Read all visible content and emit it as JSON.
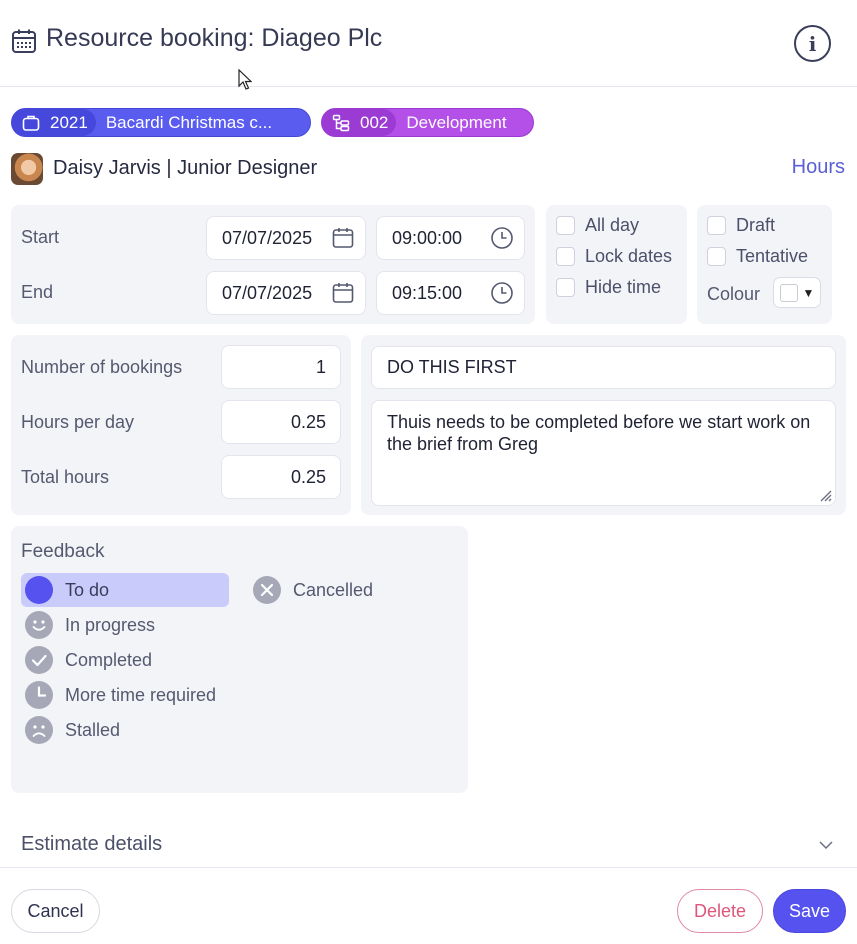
{
  "header": {
    "title": "Resource booking: Diageo Plc",
    "icons": {
      "title_icon": "calendar-icon",
      "info": "info-icon"
    }
  },
  "chips": {
    "project": {
      "number": "2021",
      "name": "Bacardi Christmas c...",
      "icon": "briefcase-icon",
      "color": "#5a5cf0"
    },
    "phase": {
      "number": "002",
      "name": "Development",
      "icon": "stages-icon",
      "color": "#b44fe8"
    }
  },
  "person": {
    "name": "Daisy Jarvis | Junior Designer"
  },
  "hours_link": "Hours",
  "dates": {
    "start_label": "Start",
    "end_label": "End",
    "start_date": "07/07/2025",
    "start_time": "09:00:00",
    "end_date": "07/07/2025",
    "end_time": "09:15:00"
  },
  "options": {
    "all_day": "All day",
    "lock_dates": "Lock dates",
    "hide_time": "Hide time",
    "draft": "Draft",
    "tentative": "Tentative",
    "colour_label": "Colour",
    "colour_value": "#ffffff"
  },
  "counts": {
    "bookings_label": "Number of bookings",
    "bookings_value": "1",
    "hpd_label": "Hours per day",
    "hpd_value": "0.25",
    "total_label": "Total hours",
    "total_value": "0.25"
  },
  "notes": {
    "title": "DO THIS FIRST",
    "body": "Thuis needs to be completed before we start work on the brief from Greg"
  },
  "feedback": {
    "title": "Feedback",
    "items": [
      {
        "label": "To do",
        "icon": "filled-circle-icon",
        "selected": true
      },
      {
        "label": "In progress",
        "icon": "smile-icon"
      },
      {
        "label": "Completed",
        "icon": "check-circle-icon"
      },
      {
        "label": "More time required",
        "icon": "clock-circle-icon"
      },
      {
        "label": "Stalled",
        "icon": "frown-icon"
      },
      {
        "label": "Cancelled",
        "icon": "x-circle-icon"
      }
    ],
    "accent": "#5552f0"
  },
  "estimate": {
    "label": "Estimate details"
  },
  "footer": {
    "cancel": "Cancel",
    "delete": "Delete",
    "save": "Save"
  }
}
